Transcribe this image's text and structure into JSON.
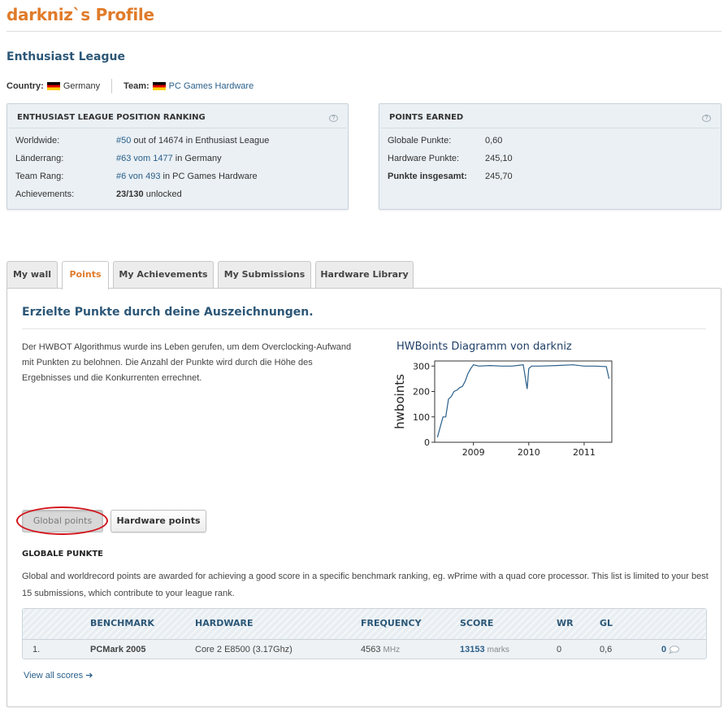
{
  "profile": {
    "title": "darkniz`s Profile",
    "league": "Enthusiast League"
  },
  "info": {
    "country_label": "Country:",
    "country": "Germany",
    "team_label": "Team:",
    "team": "PC Games Hardware"
  },
  "ranking": {
    "title": "ENTHUSIAST LEAGUE POSITION RANKING",
    "rows": [
      {
        "label": "Worldwide:",
        "link": "#50",
        "text": " out of 14674 in Enthusiast League"
      },
      {
        "label": "Länderrang:",
        "link": "#63 vom 1477",
        "text": " in Germany"
      },
      {
        "label": "Team Rang:",
        "link": "#6 von 493",
        "text": " in PC Games Hardware"
      },
      {
        "label": "Achievements:",
        "bold": "23/130",
        "text": " unlocked"
      }
    ]
  },
  "points": {
    "title": "POINTS EARNED",
    "rows": [
      {
        "label": "Globale Punkte:",
        "value": "0,60"
      },
      {
        "label": "Hardware Punkte:",
        "value": "245,10"
      },
      {
        "label": "Punkte insgesamt:",
        "value": "245,70"
      }
    ]
  },
  "help_glyph": "?",
  "tabs": [
    "My wall",
    "Points",
    "My Achievements",
    "My Submissions",
    "Hardware Library"
  ],
  "active_tab": "Points",
  "section": {
    "title": "Erzielte Punkte durch deine Auszeichnungen.",
    "intro": "Der HWBOT Algorithmus wurde ins Leben gerufen, um dem Overclocking-Aufwand mit Punkten zu belohnen. Die Anzahl der Punkte wird durch die Höhe des Ergebnisses und die Konkurrenten errechnet."
  },
  "chart_data": {
    "type": "line",
    "title": "HWBoints Diagramm von darkniz",
    "xlabel": "",
    "ylabel": "hwboints",
    "ylim": [
      0,
      320
    ],
    "yticks": [
      0,
      100,
      200,
      300
    ],
    "xticks": [
      "2009",
      "2010",
      "2011"
    ],
    "x_years": [
      2009,
      2010,
      2011
    ],
    "xlim": [
      2008.3,
      2011.5
    ],
    "grid": false,
    "series": [
      {
        "x": [
          2008.35,
          2008.4,
          2008.45,
          2008.5,
          2008.55,
          2008.6,
          2008.65,
          2008.7,
          2008.75,
          2008.8,
          2008.85,
          2008.9,
          2008.95,
          2009.0,
          2009.1,
          2009.3,
          2009.5,
          2009.7,
          2009.9,
          2009.97,
          2010.0,
          2010.05,
          2010.2,
          2010.5,
          2010.8,
          2011.0,
          2011.2,
          2011.4,
          2011.45
        ],
        "values": [
          20,
          60,
          100,
          100,
          170,
          180,
          200,
          205,
          215,
          220,
          240,
          270,
          290,
          305,
          300,
          302,
          300,
          300,
          305,
          210,
          290,
          300,
          300,
          302,
          305,
          300,
          300,
          298,
          250
        ]
      }
    ],
    "color": "#2a5f8a"
  },
  "buttons": {
    "global": "Global points",
    "hardware": "Hardware points"
  },
  "global_section": {
    "heading": "GLOBALE PUNKTE",
    "description": "Global and worldrecord points are awarded for achieving a good score in a specific benchmark ranking, eg. wPrime with a quad core processor. This list is limited to your best 15 submissions, which contribute to your league rank."
  },
  "table": {
    "headers": [
      "BENCHMARK",
      "HARDWARE",
      "FREQUENCY",
      "SCORE",
      "WR",
      "GL"
    ],
    "rows": [
      {
        "rank": "1.",
        "benchmark": "PCMark 2005",
        "hardware": "Core 2 E8500 (3.17Ghz)",
        "frequency": "4563",
        "frequency_unit": "MHz",
        "score": "13153",
        "score_unit": "marks",
        "wr": "0",
        "gl": "0,6",
        "comments": "0"
      }
    ]
  },
  "view_all": "View all scores ➔"
}
